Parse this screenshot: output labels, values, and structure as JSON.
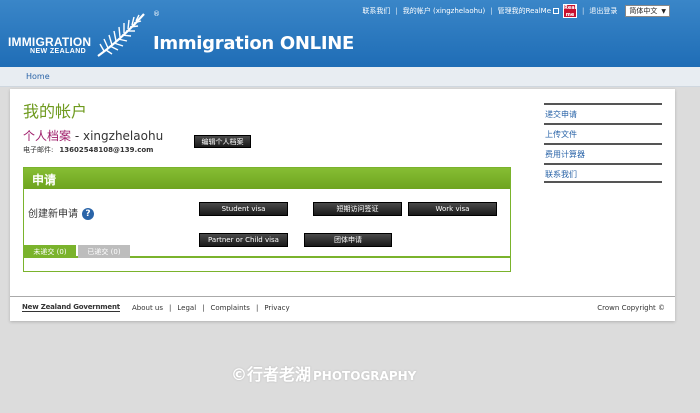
{
  "header": {
    "logo_line1": "IMMIGRATION",
    "logo_line2": "NEW ZEALAND",
    "logo_reg": "®",
    "app_title": "Immigration ONLINE",
    "nav": {
      "contact": "联系我们",
      "account": "我的帐户 (xingzhelaohu)",
      "realme": "管理我的RealMe",
      "realme_badge_top": "Real",
      "realme_badge_bottom": "me",
      "logout": "退出登录",
      "language": "简体中文"
    }
  },
  "breadcrumb": {
    "home": "Home"
  },
  "main": {
    "page_title": "我的帐户",
    "profile_label": "个人档案",
    "profile_sep": " - ",
    "username": "xingzhelaohu",
    "email_label": "电子邮件:",
    "email_value": "13602548108@139.com",
    "edit_profile": "编辑个人档案",
    "applications": {
      "title": "申请",
      "create_new": "创建新申请",
      "buttons": {
        "student_visa": "Student visa",
        "visitor_visa": "短期访问签证",
        "work_visa": "Work visa",
        "partner_child": "Partner or Child visa",
        "group": "团体申请"
      },
      "tabs": {
        "unsubmitted": "未递交 (0)",
        "submitted": "已递交 (0)"
      }
    }
  },
  "sidebar": {
    "items": [
      "递交申请",
      "上传文件",
      "费用计算器",
      "联系我们"
    ]
  },
  "footer": {
    "gov_logo": "New Zealand Government",
    "links": [
      "About us",
      "Legal",
      "Complaints",
      "Privacy"
    ],
    "copyright": "Crown Copyright ©"
  },
  "watermark": {
    "cn": "©行者老湖",
    "en": "PHOTOGRAPHY"
  },
  "colors": {
    "header_blue": "#2a78c0",
    "accent_green": "#7ab32c",
    "title_green": "#6e9a1d",
    "profile_magenta": "#a0206c",
    "link_blue": "#2a64a8"
  }
}
